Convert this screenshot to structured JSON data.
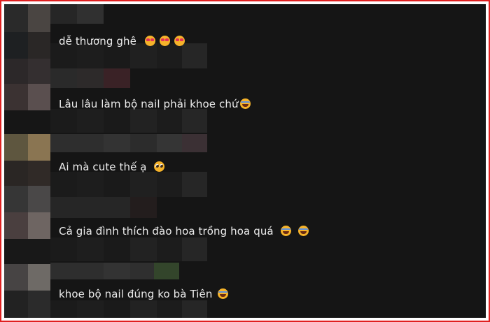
{
  "comments": [
    {
      "text": "dễ thương ghê",
      "emojis": [
        "smiling-face-with-heart-eyes",
        "smiling-face-with-heart-eyes",
        "smiling-face-with-heart-eyes"
      ]
    },
    {
      "text": "Lâu lâu làm bộ nail phải khoe chứ",
      "emojis": [
        "face-with-tears-of-joy"
      ]
    },
    {
      "text": "Ai mà cute thế ạ",
      "emojis": [
        "pleading-face"
      ]
    },
    {
      "text": "Cả gia đình thích đào hoa trồng hoa quá",
      "emojis": [
        "face-with-tears-of-joy",
        "face-with-tears-of-joy"
      ]
    },
    {
      "text": "khoe bộ nail đúng ko bà Tiên",
      "emojis": [
        "face-with-tears-of-joy"
      ]
    }
  ],
  "colors": {
    "frame_border": "#e02020",
    "background": "#151515",
    "comment_text": "#ececec",
    "emoji_face": "#f6b32a"
  }
}
